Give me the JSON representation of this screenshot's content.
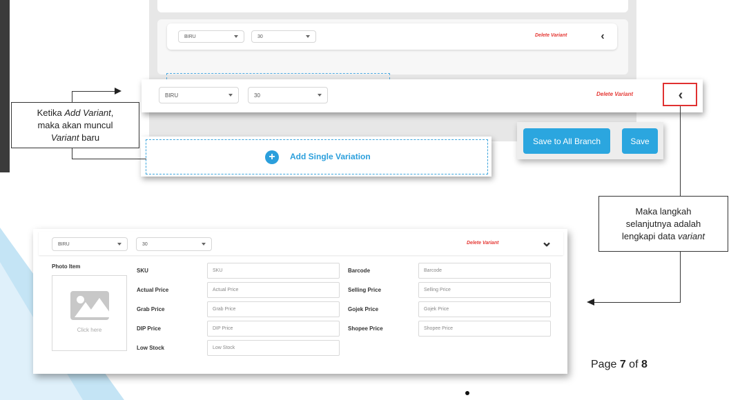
{
  "background_variant": {
    "color_select": "BIRU",
    "size_select": "30",
    "delete_label": "Delete Variant",
    "chevron": "‹"
  },
  "zoomed_variant": {
    "color_select": "BIRU",
    "size_select": "30",
    "delete_label": "Delete Variant",
    "chevron": "‹"
  },
  "add_variation": {
    "plus": "+",
    "label": "Add Single Variation"
  },
  "buttons": {
    "save_all": "Save to All Branch",
    "save": "Save"
  },
  "callout_left": {
    "line1_a": "Ketika ",
    "line1_b": "Add Variant",
    "line1_c": ",",
    "line2": "maka akan muncul",
    "line3_a": "Variant",
    "line3_b": " baru"
  },
  "callout_right": {
    "line1": "Maka langkah",
    "line2": "selanjutnya adalah",
    "line3_a": "lengkapi data ",
    "line3_b": "variant"
  },
  "variant_form": {
    "color_select": "BIRU",
    "size_select": "30",
    "delete_label": "Delete Variant",
    "chevron": "⌄",
    "photo_label": "Photo Item",
    "click_here": "Click here",
    "fields": {
      "sku": {
        "label": "SKU",
        "placeholder": "SKU"
      },
      "barcode": {
        "label": "Barcode",
        "placeholder": "Barcode"
      },
      "actual_price": {
        "label": "Actual Price",
        "placeholder": "Actual Price"
      },
      "selling_price": {
        "label": "Selling Price",
        "placeholder": "Selling Price"
      },
      "grab_price": {
        "label": "Grab Price",
        "placeholder": "Grab Price"
      },
      "gojek_price": {
        "label": "Gojek Price",
        "placeholder": "Gojek Price"
      },
      "dip_price": {
        "label": "DIP Price",
        "placeholder": "DIP Price"
      },
      "shopee_price": {
        "label": "Shopee Price",
        "placeholder": "Shopee Price"
      },
      "low_stock": {
        "label": "Low Stock",
        "placeholder": "Low Stock"
      }
    }
  },
  "footer": {
    "page_prefix": "Page ",
    "page_current": "7",
    "page_of": " of ",
    "page_total": "8"
  },
  "colors": {
    "accent": "#2ba6df",
    "delete": "#e53935",
    "highlight": "#e03030"
  }
}
